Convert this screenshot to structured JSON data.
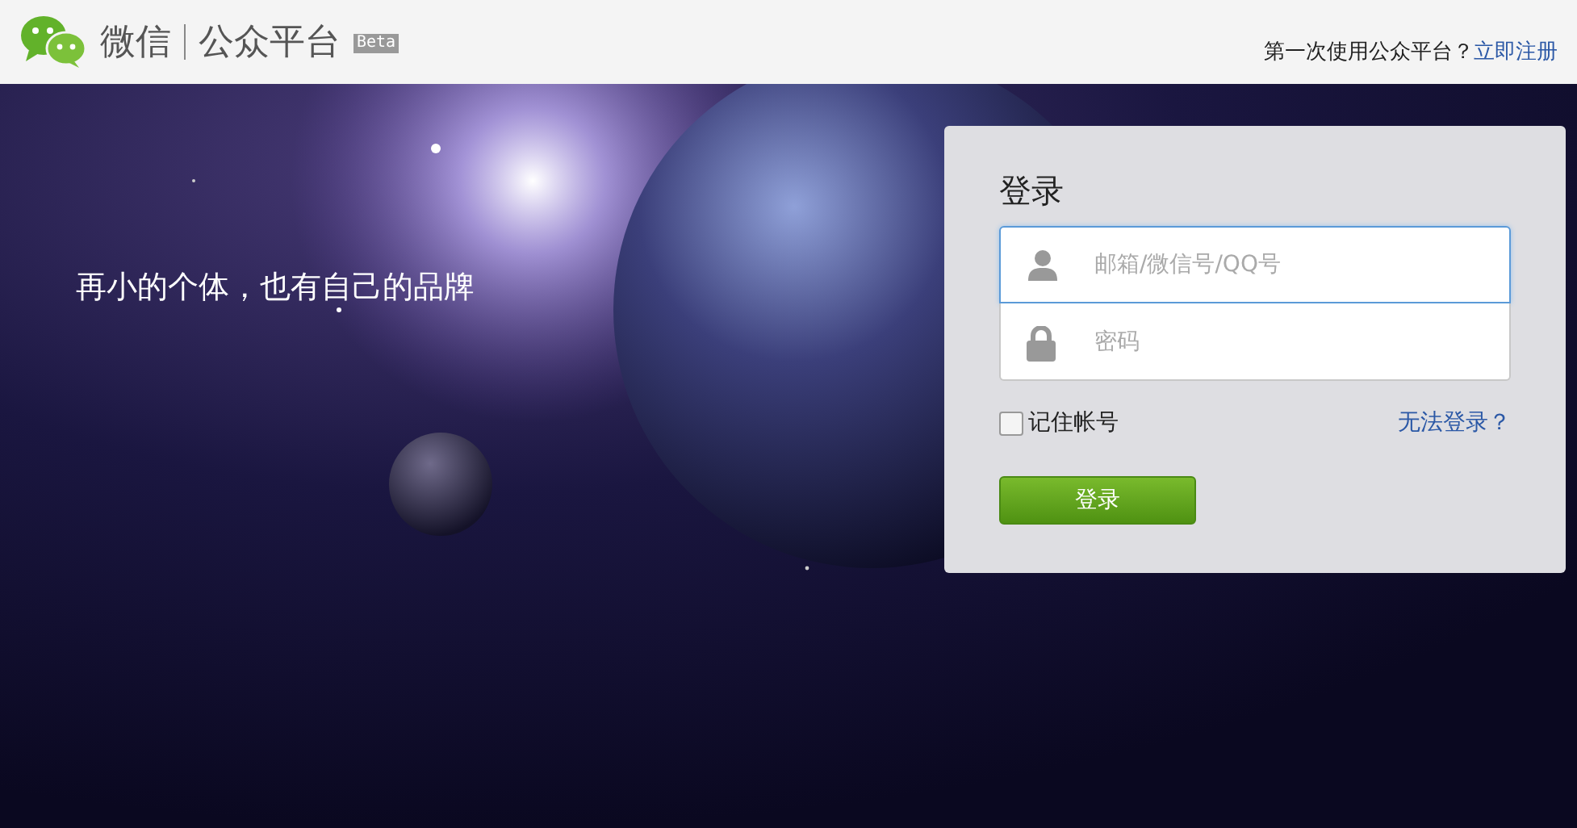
{
  "header": {
    "logo_name": "微信",
    "product": "公众平台",
    "badge": "Beta",
    "signup_prompt": "第一次使用公众平台？",
    "signup_link": "立即注册"
  },
  "slogan": "再小的个体，也有自己的品牌",
  "login": {
    "title": "登录",
    "fields": [
      {
        "kind": "account",
        "placeholder": "邮箱/微信号/QQ号",
        "focused": true
      },
      {
        "kind": "password",
        "placeholder": "密码",
        "focused": false
      }
    ],
    "remember": {
      "label": "记住帐号",
      "checked": false
    },
    "help_link": "无法登录？",
    "submit": "登录"
  }
}
